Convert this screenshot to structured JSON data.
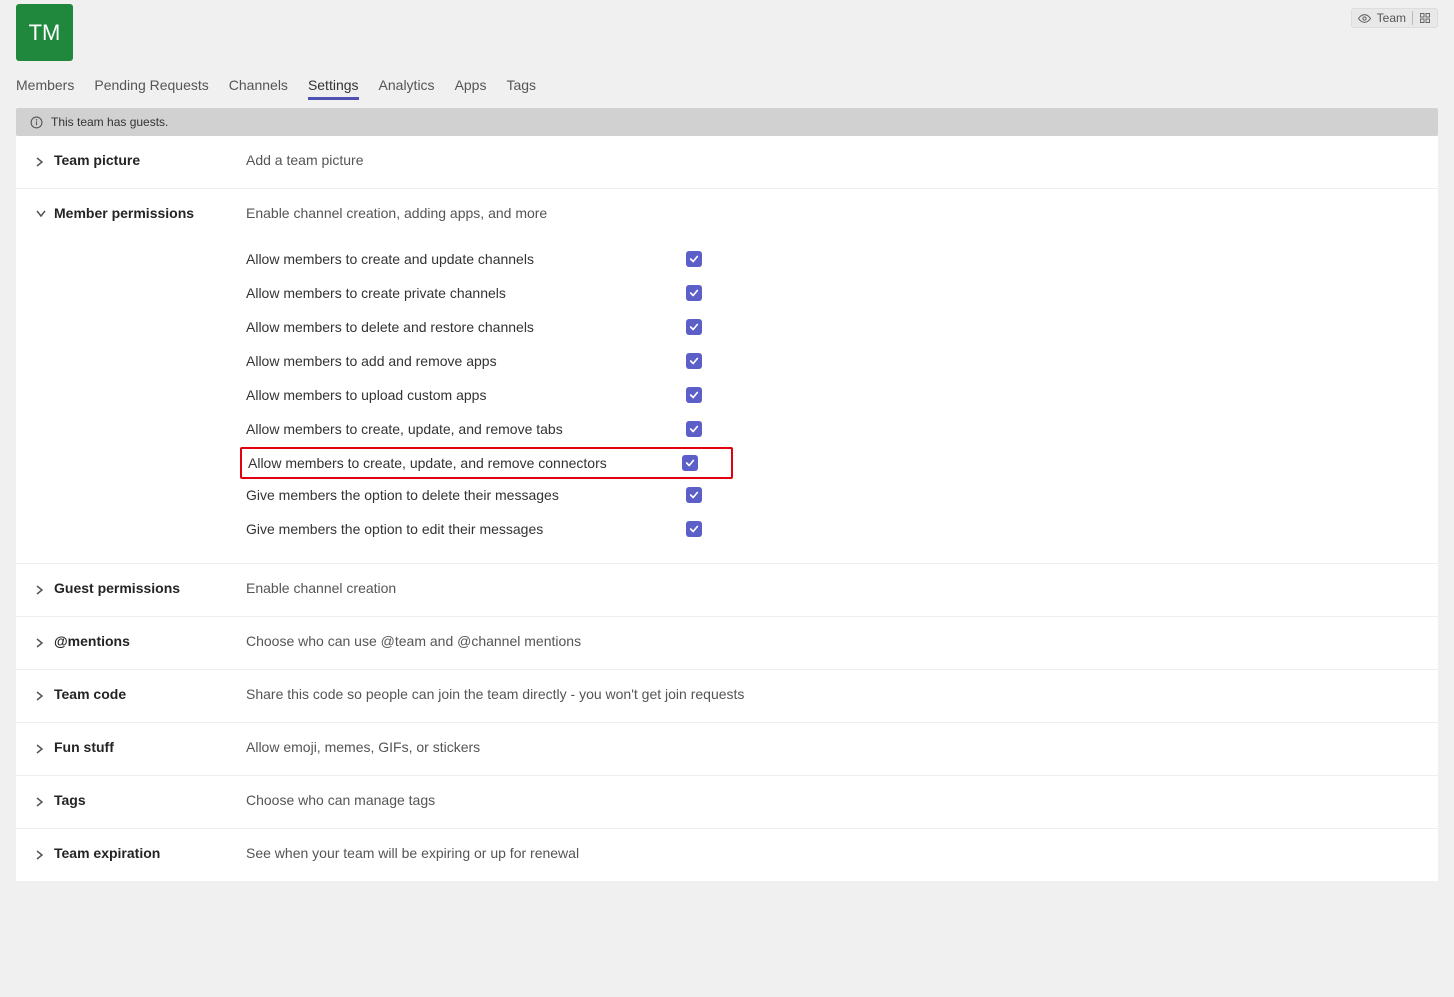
{
  "team": {
    "avatar_initials": "TM",
    "badge_label": "Team"
  },
  "tabs": [
    "Members",
    "Pending Requests",
    "Channels",
    "Settings",
    "Analytics",
    "Apps",
    "Tags"
  ],
  "active_tab_index": 3,
  "info_bar": "This team has guests.",
  "sections": {
    "team_picture": {
      "title": "Team picture",
      "desc": "Add a team picture"
    },
    "member_permissions": {
      "title": "Member permissions",
      "desc": "Enable channel creation, adding apps, and more",
      "items": [
        {
          "label": "Allow members to create and update channels",
          "checked": true,
          "highlight": false
        },
        {
          "label": "Allow members to create private channels",
          "checked": true,
          "highlight": false
        },
        {
          "label": "Allow members to delete and restore channels",
          "checked": true,
          "highlight": false
        },
        {
          "label": "Allow members to add and remove apps",
          "checked": true,
          "highlight": false
        },
        {
          "label": "Allow members to upload custom apps",
          "checked": true,
          "highlight": false
        },
        {
          "label": "Allow members to create, update, and remove tabs",
          "checked": true,
          "highlight": false
        },
        {
          "label": "Allow members to create, update, and remove connectors",
          "checked": true,
          "highlight": true
        },
        {
          "label": "Give members the option to delete their messages",
          "checked": true,
          "highlight": false
        },
        {
          "label": "Give members the option to edit their messages",
          "checked": true,
          "highlight": false
        }
      ]
    },
    "guest_permissions": {
      "title": "Guest permissions",
      "desc": "Enable channel creation"
    },
    "mentions": {
      "title": "@mentions",
      "desc": "Choose who can use @team and @channel mentions"
    },
    "team_code": {
      "title": "Team code",
      "desc": "Share this code so people can join the team directly - you won't get join requests"
    },
    "fun_stuff": {
      "title": "Fun stuff",
      "desc": "Allow emoji, memes, GIFs, or stickers"
    },
    "tags": {
      "title": "Tags",
      "desc": "Choose who can manage tags"
    },
    "team_expiration": {
      "title": "Team expiration",
      "desc": "See when your team will be expiring or up for renewal"
    }
  }
}
